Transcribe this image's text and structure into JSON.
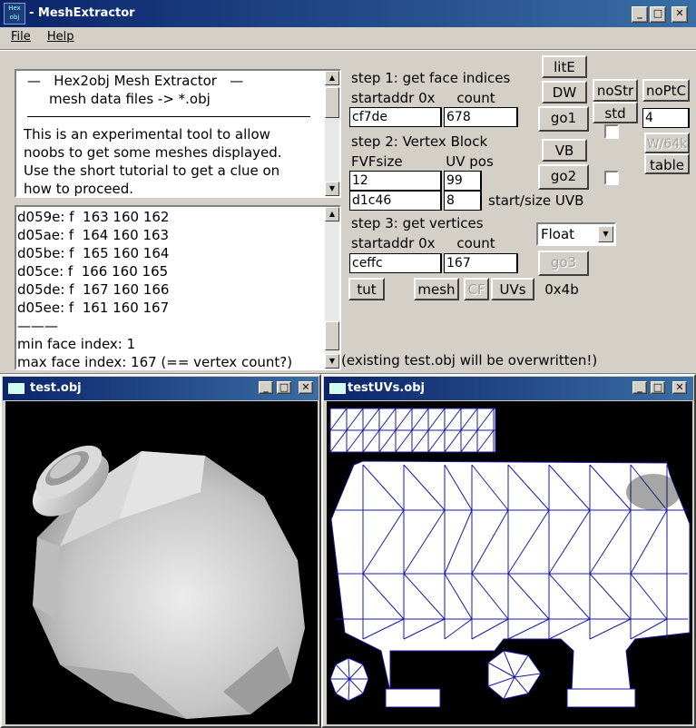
{
  "main_window": {
    "title": "MeshExtractor",
    "icon_text": "Hex obj"
  },
  "menu": {
    "file": "File",
    "help": "Help"
  },
  "info": {
    "line1": "—   Hex2obj Mesh Extractor   —",
    "line2": "mesh data files -> *.obj",
    "line3": "This is an experimental tool to allow",
    "line4": "noobs to get some meshes displayed.",
    "line5": "Use the short tutorial to get a clue on",
    "line6": "how to proceed."
  },
  "log": {
    "lines": [
      "d059e: f  163 160 162",
      "d05ae: f  164 160 163",
      "d05be: f  165 160 164",
      "d05ce: f  166 160 165",
      "d05de: f  167 160 166",
      "d05ee: f  161 160 167",
      "———",
      "min face index: 1",
      "max face index: 167 (== vertex count?)"
    ]
  },
  "step1": {
    "title": "step 1: get face indices",
    "labels": "startaddr 0x     count",
    "startaddr": "cf7de",
    "count": "678",
    "go": "go1"
  },
  "step2": {
    "title": "step 2: Vertex Block",
    "labels": "FVFsize          UV pos",
    "fvfsize": "12",
    "uvpos": "99",
    "addr": "d1c46",
    "size": "8",
    "uvb_label": "start/size UVB",
    "go": "go2"
  },
  "step3": {
    "title": "step 3: get vertices",
    "labels": "startaddr 0x     count",
    "startaddr": "ceffc",
    "count": "167",
    "go": "go3",
    "type_select": "Float"
  },
  "buttons": {
    "lite": "litE",
    "dw": "DW",
    "nostr": "noStr",
    "noptc": "noPtC",
    "std": "std",
    "std_value": "4",
    "vb": "VB",
    "w64k": "W/64k",
    "table": "table",
    "tut": "tut",
    "mesh": "mesh",
    "cf": "CF",
    "uvs": "UVs",
    "hex": "0x4b"
  },
  "warning": "(existing test.obj will be overwritten!)",
  "obj_window": {
    "title": "test.obj"
  },
  "uv_window": {
    "title": "testUVs.obj"
  },
  "colors": {
    "titlebar": "#0a246a",
    "dialog": "#d4d0c8",
    "uv_lines": "#1a1aa0"
  }
}
